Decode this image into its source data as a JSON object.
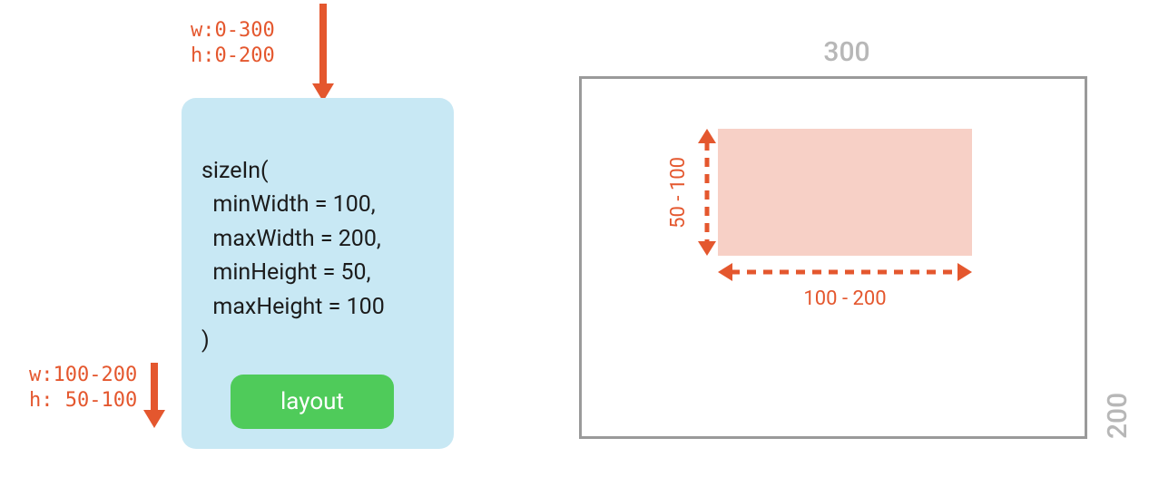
{
  "constraints_in": {
    "w": "w:0-300",
    "h": "h:0-200"
  },
  "constraints_out": {
    "w": "w:100-200",
    "h": "h: 50-100"
  },
  "code": {
    "fn": "sizeIn(",
    "l1": "  minWidth = 100,",
    "l2": "  maxWidth = 200,",
    "l3": "  minHeight = 50,",
    "l4": "  maxHeight = 100",
    "close": ")"
  },
  "layout_label": "layout",
  "canvas": {
    "w_label": "300",
    "h_label": "200"
  },
  "range": {
    "w_label": "100 - 200",
    "h_label": "50 - 100"
  },
  "colors": {
    "accent": "#E4572E",
    "box": "#C8E8F4",
    "btn": "#4FCB5A",
    "fill": "#F7D0C6",
    "border": "#9A9A9A"
  }
}
